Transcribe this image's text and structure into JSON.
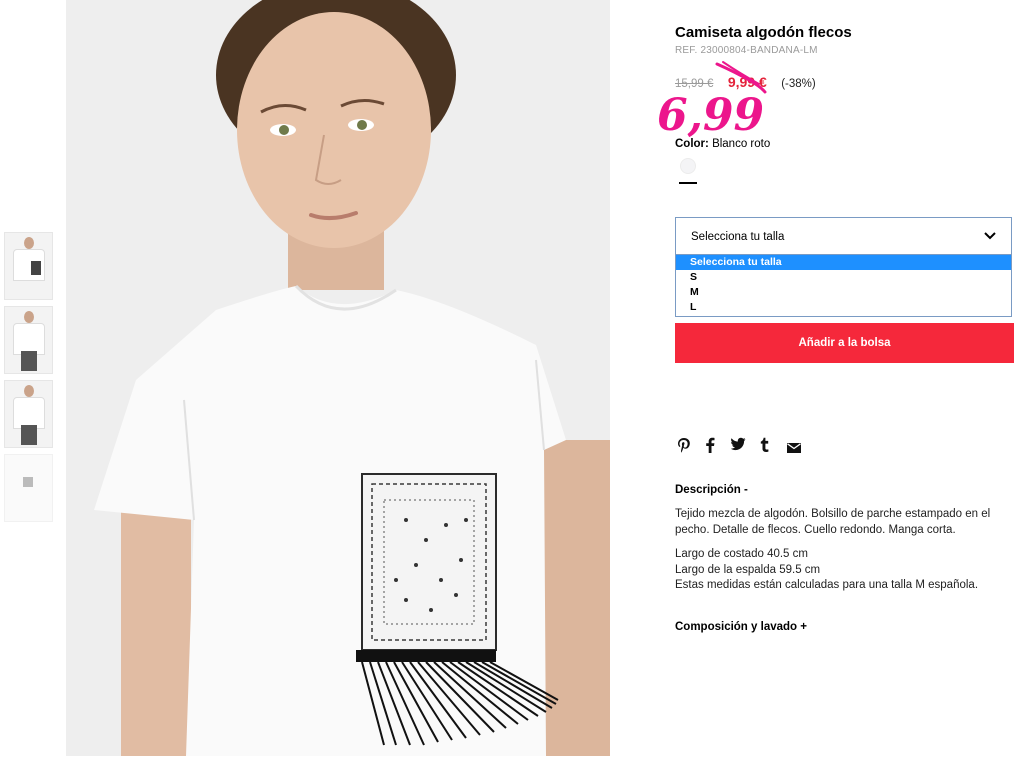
{
  "product": {
    "title": "Camiseta algodón flecos",
    "ref": "REF. 23000804-BANDANA-LM",
    "old_price": "15,99 €",
    "sale_price": "9,99 €",
    "discount": "(-38%)",
    "handwritten_price": "6,99",
    "color_label": "Color:",
    "color_value": "Blanco roto"
  },
  "size_select": {
    "placeholder": "Selecciona tu talla",
    "options": [
      "Selecciona tu talla",
      "S",
      "M",
      "L"
    ],
    "selected_index": 0
  },
  "add_button": {
    "label": "Añadir a la bolsa"
  },
  "share_icons": [
    "pinterest-icon",
    "facebook-icon",
    "twitter-icon",
    "tumblr-icon",
    "email-icon"
  ],
  "description": {
    "heading": "Descripción -",
    "paragraphs": [
      "Tejido mezcla de algodón. Bolsillo de parche estampado en el pecho. Detalle de flecos. Cuello redondo. Manga corta.",
      "Largo de costado 40.5 cm",
      "Largo de la espalda 59.5 cm",
      "Estas medidas están calculadas para una talla M española."
    ]
  },
  "composition": {
    "heading": "Composición y lavado +"
  },
  "colors": {
    "accent_red": "#f5283b",
    "sale_red": "#e4233a",
    "handwritten_pink": "#ec168c",
    "select_highlight": "#1e90ff"
  }
}
